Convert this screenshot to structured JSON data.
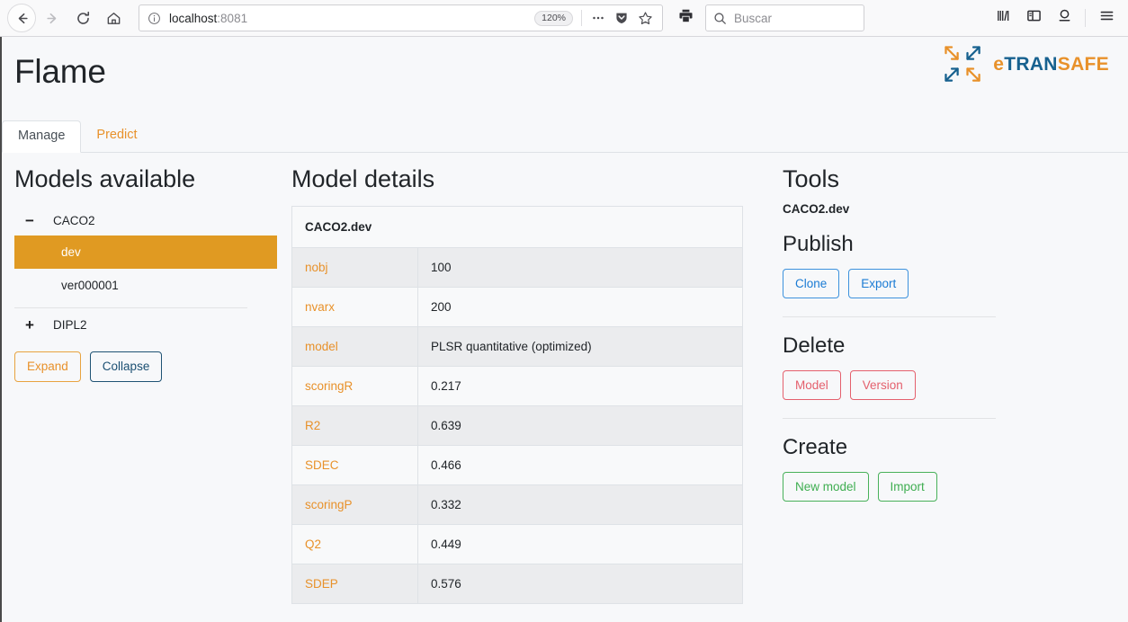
{
  "browser": {
    "nav": {
      "back": "back-arrow",
      "forward": "forward-arrow",
      "reload": "reload",
      "home": "home"
    },
    "url": {
      "host": "localhost",
      "port": ":8081",
      "full": "localhost:8081",
      "zoom_level": "120%",
      "info_icon": "info-circle-icon",
      "menu_icon": "page-actions-ellipsis-icon",
      "shield_icon": "pocket-shield-icon",
      "bookmark_icon": "bookmark-star-icon"
    },
    "print_icon": "print-icon",
    "search": {
      "placeholder": "Buscar",
      "icon": "search-icon"
    },
    "toolbar_icons": {
      "library": "library-icon",
      "sidebar": "sidebar-icon",
      "account": "account-icon",
      "menu": "hamburger-menu-icon"
    }
  },
  "app": {
    "title": "Flame",
    "brand": {
      "e": "e",
      "tran": "TRAN",
      "safe": "SAFE",
      "full": "eTRANSAFE"
    },
    "tabs": [
      {
        "label": "Manage",
        "active": true
      },
      {
        "label": "Predict",
        "active": false
      }
    ]
  },
  "models_panel": {
    "heading": "Models available",
    "tree": [
      {
        "label": "CACO2",
        "toggle": "−",
        "expanded": true
      },
      {
        "label": "DIPL2",
        "toggle": "+",
        "expanded": false
      }
    ],
    "caco2_versions": [
      {
        "label": "dev",
        "selected": true
      },
      {
        "label": "ver000001",
        "selected": false
      }
    ],
    "buttons": {
      "expand": "Expand",
      "collapse": "Collapse"
    }
  },
  "details_panel": {
    "heading": "Model details",
    "table_title": "CACO2.dev",
    "rows": [
      {
        "key": "nobj",
        "value": "100"
      },
      {
        "key": "nvarx",
        "value": "200"
      },
      {
        "key": "model",
        "value": "PLSR quantitative (optimized)"
      },
      {
        "key": "scoringR",
        "value": "0.217"
      },
      {
        "key": "R2",
        "value": "0.639"
      },
      {
        "key": "SDEC",
        "value": "0.466"
      },
      {
        "key": "scoringP",
        "value": "0.332"
      },
      {
        "key": "Q2",
        "value": "0.449"
      },
      {
        "key": "SDEP",
        "value": "0.576"
      }
    ]
  },
  "tools_panel": {
    "heading": "Tools",
    "subtitle": "CACO2.dev",
    "groups": [
      {
        "title": "Publish",
        "buttons": [
          {
            "label": "Clone",
            "style": "blue"
          },
          {
            "label": "Export",
            "style": "blue"
          }
        ]
      },
      {
        "title": "Delete",
        "buttons": [
          {
            "label": "Model",
            "style": "red"
          },
          {
            "label": "Version",
            "style": "red"
          }
        ]
      },
      {
        "title": "Create",
        "buttons": [
          {
            "label": "New model",
            "style": "green"
          },
          {
            "label": "Import",
            "style": "green"
          }
        ]
      }
    ]
  },
  "colors": {
    "accent_orange": "#e8912a",
    "selected_row_orange": "#e09a22",
    "brand_blue": "#17618f",
    "button_blue": "#1a7bd4",
    "button_red": "#e4606d",
    "button_green": "#3fae51",
    "page_bg": "#f7f8fa"
  }
}
